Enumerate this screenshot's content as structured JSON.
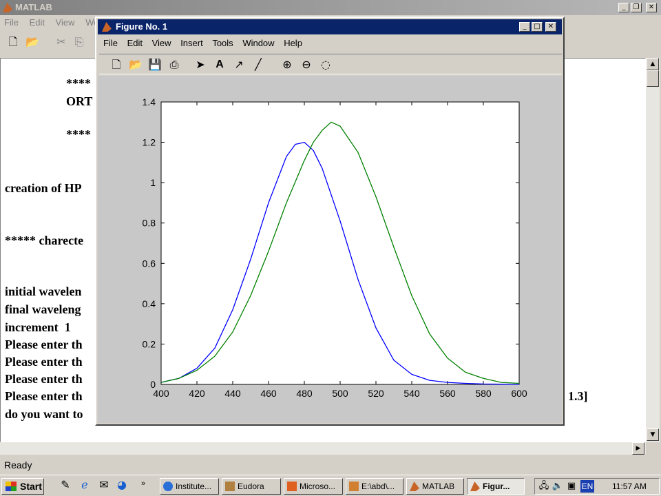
{
  "matlab": {
    "title": "MATLAB",
    "menu": [
      "File",
      "Edit",
      "View",
      "We"
    ],
    "command_lines": [
      "****",
      "ORT",
      "****",
      "creation of HP",
      "***** charecte",
      "initial wavelen",
      "final waveleng",
      "increment  1",
      "Please enter th",
      "Please enter th",
      "Please enter th",
      "Please enter th",
      "do you want to",
      "1.3]"
    ],
    "status": "Ready"
  },
  "figure": {
    "title": "Figure No. 1",
    "menu": [
      "File",
      "Edit",
      "View",
      "Insert",
      "Tools",
      "Window",
      "Help"
    ],
    "toolbar_icons": [
      "new-file-icon",
      "open-folder-icon",
      "save-icon",
      "print-icon",
      "select-arrow-icon",
      "text-icon",
      "arrow-icon",
      "line-icon",
      "zoom-in-icon",
      "zoom-out-icon",
      "rotate-icon"
    ]
  },
  "chart_data": {
    "type": "line",
    "title": "",
    "xlabel": "",
    "ylabel": "",
    "xlim": [
      400,
      600
    ],
    "ylim": [
      0,
      1.4
    ],
    "xticks": [
      400,
      420,
      440,
      460,
      480,
      500,
      520,
      540,
      560,
      580,
      600
    ],
    "yticks": [
      0,
      0.2,
      0.4,
      0.6,
      0.8,
      1,
      1.2,
      1.4
    ],
    "grid": false,
    "series": [
      {
        "color": "#0000ff",
        "x": [
          400,
          410,
          420,
          430,
          440,
          450,
          460,
          470,
          475,
          480,
          485,
          490,
          500,
          510,
          520,
          530,
          540,
          550,
          560,
          570,
          580,
          590,
          600
        ],
        "y": [
          0.01,
          0.03,
          0.08,
          0.18,
          0.37,
          0.62,
          0.9,
          1.13,
          1.19,
          1.2,
          1.16,
          1.07,
          0.81,
          0.52,
          0.28,
          0.12,
          0.05,
          0.02,
          0.01,
          0.005,
          0.002,
          0.001,
          0
        ]
      },
      {
        "color": "#008000",
        "x": [
          400,
          410,
          420,
          430,
          440,
          450,
          460,
          470,
          480,
          485,
          490,
          495,
          500,
          510,
          520,
          530,
          540,
          550,
          560,
          570,
          580,
          590,
          600
        ],
        "y": [
          0.01,
          0.03,
          0.07,
          0.14,
          0.26,
          0.44,
          0.66,
          0.9,
          1.11,
          1.2,
          1.26,
          1.3,
          1.28,
          1.15,
          0.93,
          0.68,
          0.44,
          0.25,
          0.13,
          0.06,
          0.03,
          0.01,
          0.005
        ]
      }
    ]
  },
  "taskbar": {
    "start": "Start",
    "items": [
      "Institute...",
      "Eudora",
      "Microso...",
      "E:\\abd\\...",
      "MATLAB",
      "Figur..."
    ],
    "lang": "EN",
    "clock": "11:57 AM"
  },
  "colors": {
    "active_title": "#0a246a",
    "inactive_title": "#808080",
    "series_blue": "#0000ff",
    "series_green": "#008000"
  }
}
